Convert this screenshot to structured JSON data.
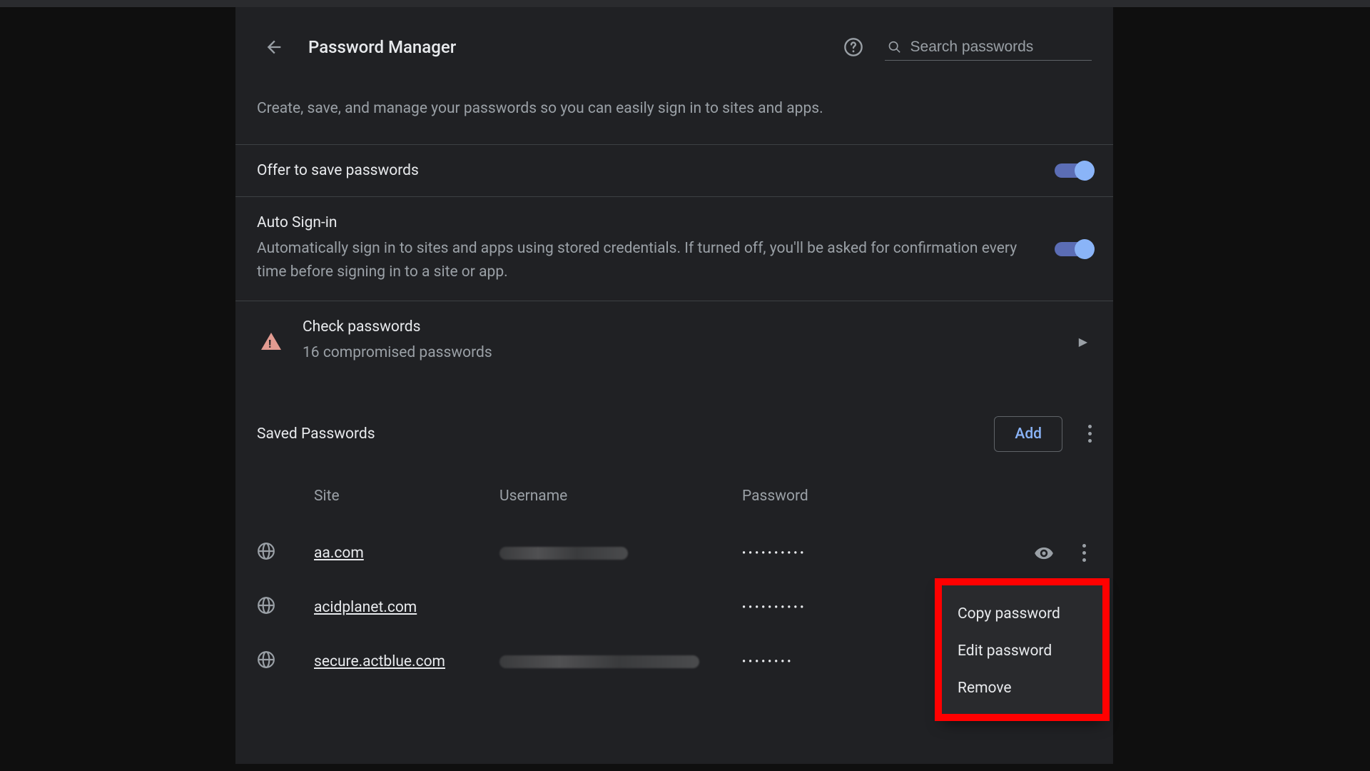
{
  "header": {
    "title": "Password Manager",
    "search_placeholder": "Search passwords"
  },
  "intro": "Create, save, and manage your passwords so you can easily sign in to sites and apps.",
  "settings": {
    "offer_save": {
      "label": "Offer to save passwords",
      "enabled": true
    },
    "auto_signin": {
      "label": "Auto Sign-in",
      "description": "Automatically sign in to sites and apps using stored credentials. If turned off, you'll be asked for confirmation every time before signing in to a site or app.",
      "enabled": true
    }
  },
  "check_passwords": {
    "title": "Check passwords",
    "subtitle": "16 compromised passwords"
  },
  "saved": {
    "heading": "Saved Passwords",
    "add_label": "Add",
    "columns": {
      "site": "Site",
      "username": "Username",
      "password": "Password"
    },
    "rows": [
      {
        "site": "aa.com",
        "password_mask": "••••••••••",
        "username_redacted": true,
        "redact_long": false
      },
      {
        "site": "acidplanet.com",
        "password_mask": "••••••••••",
        "username_redacted": false,
        "redact_long": false
      },
      {
        "site": "secure.actblue.com",
        "password_mask": "••••••••",
        "username_redacted": true,
        "redact_long": true
      }
    ]
  },
  "context_menu": {
    "copy": "Copy password",
    "edit": "Edit password",
    "remove": "Remove"
  }
}
